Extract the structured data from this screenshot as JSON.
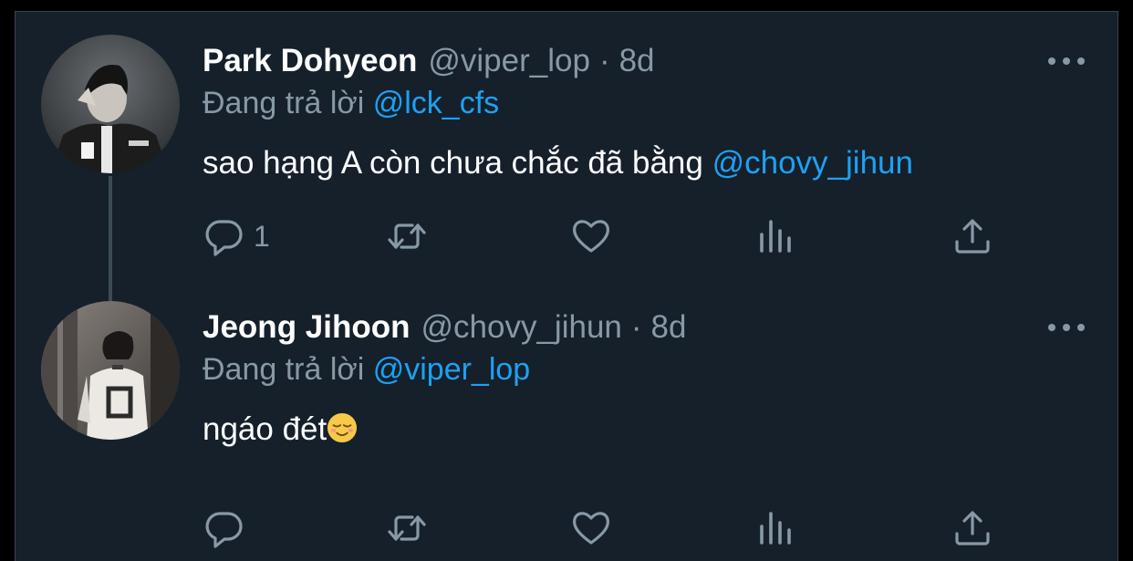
{
  "tweets": [
    {
      "name": "Park Dohyeon",
      "handle": "@viper_lop",
      "separator": "·",
      "time": "8d",
      "replying_prefix": "Đang trả lời",
      "replying_to": "@lck_cfs",
      "text": "sao hạng A còn chưa chắc đã bằng",
      "text_mention": "@chovy_jihun",
      "reply_count": "1"
    },
    {
      "name": "Jeong Jihoon",
      "handle": "@chovy_jihun",
      "separator": "·",
      "time": "8d",
      "replying_prefix": "Đang trả lời",
      "replying_to": "@viper_lop",
      "text": "ngáo đét",
      "emoji": "relieved-face-emoji",
      "reply_count": ""
    }
  ],
  "icons": {
    "reply": "reply-icon",
    "retweet": "retweet-icon",
    "like": "like-icon",
    "stats": "stats-icon",
    "share": "share-icon",
    "more": "more-icon"
  },
  "colors": {
    "background": "#15202b",
    "text_primary": "#ffffff",
    "text_secondary": "#8899a6",
    "accent": "#1da1f2"
  }
}
